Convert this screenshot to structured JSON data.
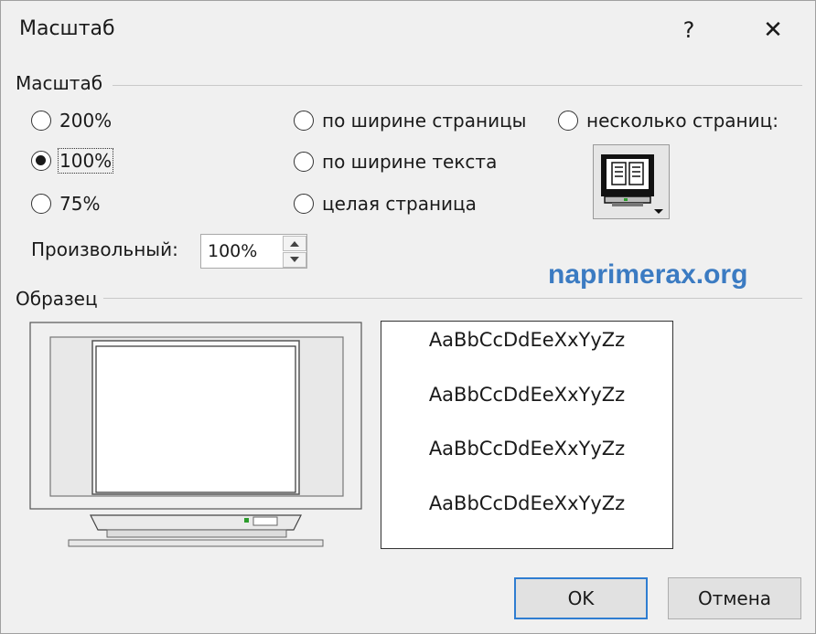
{
  "window": {
    "title": "Масштаб",
    "help_label": "?",
    "close_label": "✕"
  },
  "zoom_group": {
    "label": "Масштаб",
    "options": [
      {
        "label": "200%",
        "selected": false
      },
      {
        "label": "100%",
        "selected": true
      },
      {
        "label": "75%",
        "selected": false
      },
      {
        "label": "по ширине страницы",
        "selected": false
      },
      {
        "label": "по ширине текста",
        "selected": false
      },
      {
        "label": "целая страница",
        "selected": false
      },
      {
        "label": "несколько страниц:",
        "selected": false
      }
    ],
    "pages_button_icon": "monitor-pages-icon",
    "custom_label": "Произвольный:",
    "custom_value": "100%"
  },
  "watermark": "naprimerax.org",
  "preview_group": {
    "label": "Образец",
    "monitor_icon": "monitor-preview",
    "sample_lines": [
      "AaBbCcDdEeXxYyZz",
      "AaBbCcDdEeXxYyZz",
      "AaBbCcDdEeXxYyZz",
      "AaBbCcDdEeXxYyZz"
    ]
  },
  "buttons": {
    "ok_label": "OK",
    "cancel_label": "Отмена"
  },
  "colors": {
    "dialog_bg": "#f0f0f0",
    "ok_border": "#2f7dd1",
    "watermark": "#3b7bc2"
  }
}
